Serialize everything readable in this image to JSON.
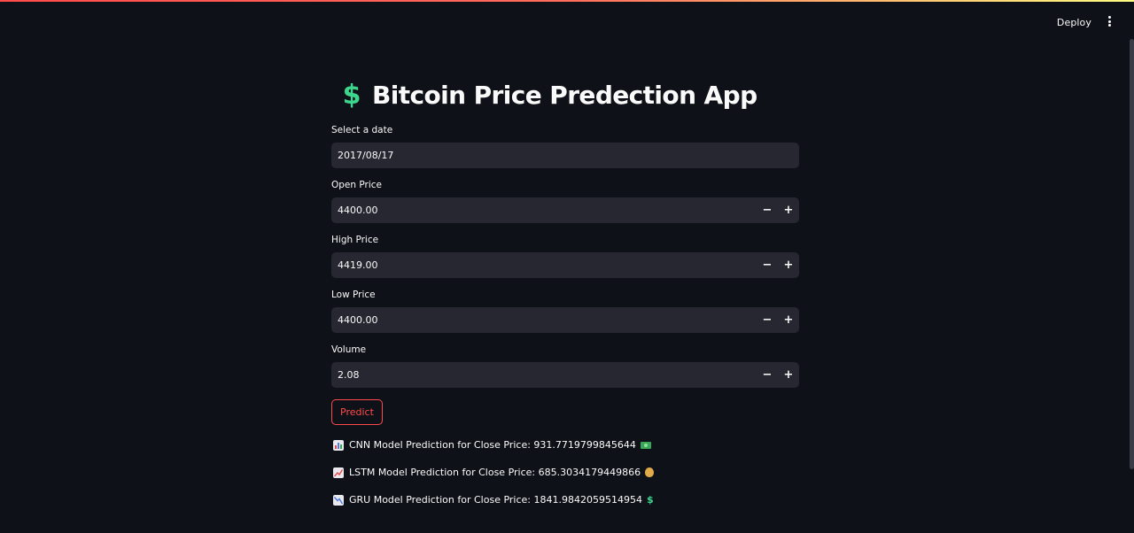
{
  "header": {
    "deploy_label": "Deploy",
    "menu_icon": "more-vertical-icon"
  },
  "app": {
    "title_icon": "$",
    "title": "Bitcoin Price Predection App"
  },
  "form": {
    "date": {
      "label": "Select a date",
      "value": "2017/08/17"
    },
    "open": {
      "label": "Open Price",
      "value": "4400.00"
    },
    "high": {
      "label": "High Price",
      "value": "4419.00"
    },
    "low": {
      "label": "Low Price",
      "value": "4400.00"
    },
    "volume": {
      "label": "Volume",
      "value": "2.08"
    },
    "stepper": {
      "minus": "−",
      "plus": "+"
    },
    "predict_label": "Predict"
  },
  "results": [
    {
      "icon": "bar-chart-icon",
      "text": "CNN Model Prediction for Close Price: 931.7719799845644",
      "trail_icon": "money-bill-icon"
    },
    {
      "icon": "chart-increasing-icon",
      "text": "LSTM Model Prediction for Close Price: 685.3034179449866",
      "trail_icon": "money-bag-icon"
    },
    {
      "icon": "chart-decreasing-icon",
      "text": "GRU Model Prediction for Close Price: 1841.9842059514954",
      "trail_icon": "dollar-sign-icon",
      "trail_text": "$"
    }
  ],
  "colors": {
    "background": "#0e1117",
    "input_bg": "#262730",
    "accent_red": "#ff4b4b",
    "accent_green": "#3dd68c"
  }
}
